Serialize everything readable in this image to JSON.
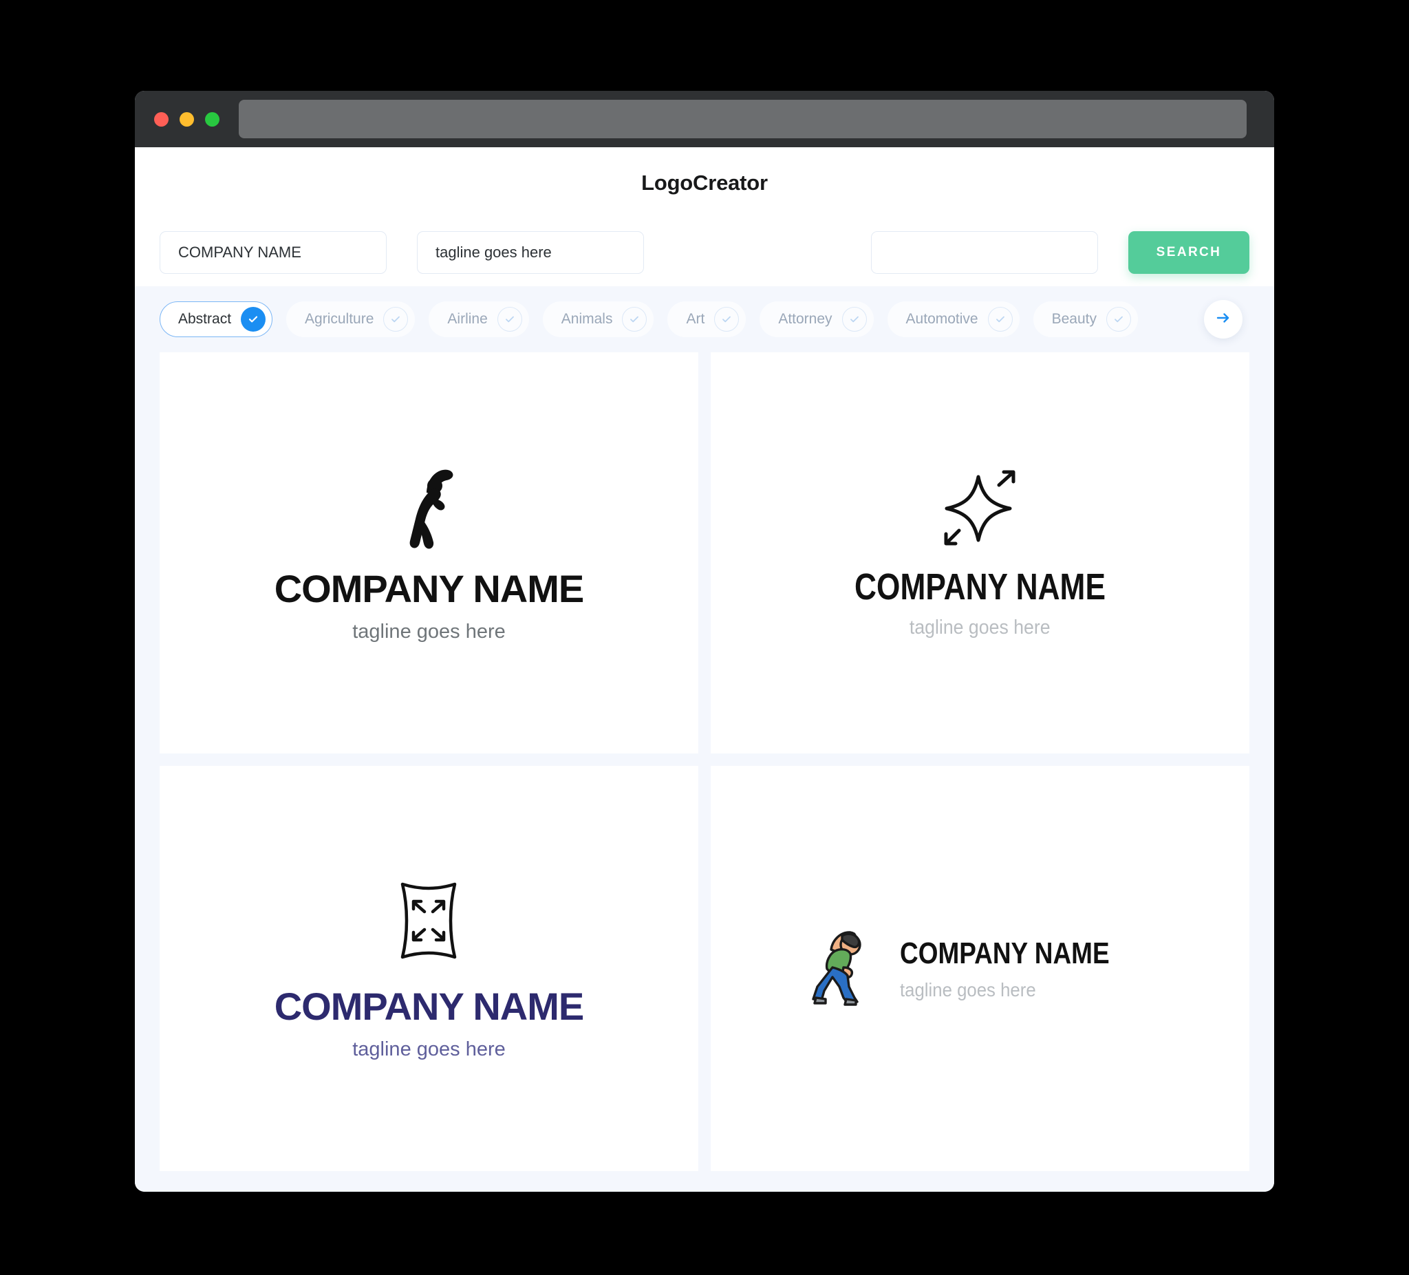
{
  "window": {
    "traffic_lights": [
      "close",
      "minimize",
      "maximize"
    ],
    "url_value": ""
  },
  "header": {
    "title": "LogoCreator"
  },
  "search": {
    "company_value": "COMPANY NAME",
    "company_placeholder": "COMPANY NAME",
    "tagline_value": "tagline goes here",
    "tagline_placeholder": "tagline goes here",
    "extra_value": "",
    "extra_placeholder": "",
    "button_label": "SEARCH",
    "button_color": "#54cc9a"
  },
  "filters": {
    "accent_color": "#1b8ef2",
    "next_icon": "arrow-right-icon",
    "chips": [
      {
        "label": "Abstract",
        "selected": true
      },
      {
        "label": "Agriculture",
        "selected": false
      },
      {
        "label": "Airline",
        "selected": false
      },
      {
        "label": "Animals",
        "selected": false
      },
      {
        "label": "Art",
        "selected": false
      },
      {
        "label": "Attorney",
        "selected": false
      },
      {
        "label": "Automotive",
        "selected": false
      },
      {
        "label": "Beauty",
        "selected": false
      }
    ]
  },
  "results": [
    {
      "icon": "stretching-person-silhouette-icon",
      "company": "COMPANY NAME",
      "tagline": "tagline goes here",
      "layout": "stacked",
      "color": "#111111"
    },
    {
      "icon": "sparkle-star-arrows-icon",
      "company": "COMPANY NAME",
      "tagline": "tagline goes here",
      "layout": "stacked",
      "color": "#111111"
    },
    {
      "icon": "expand-square-arrows-icon",
      "company": "COMPANY NAME",
      "tagline": "tagline goes here",
      "layout": "stacked",
      "color": "#2d2a6e"
    },
    {
      "icon": "stretching-person-color-icon",
      "company": "COMPANY NAME",
      "tagline": "tagline goes here",
      "layout": "horizontal",
      "color": "#111111"
    }
  ]
}
